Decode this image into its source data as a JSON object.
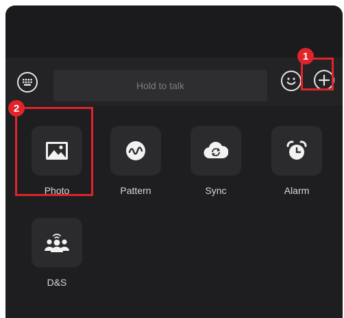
{
  "input_bar": {
    "hold_to_talk": "Hold to talk",
    "keyboard_icon": "keyboard-icon",
    "emoji_icon": "emoji-icon",
    "plus_icon": "plus-icon"
  },
  "features": [
    {
      "label": "Photo",
      "icon": "photo-icon"
    },
    {
      "label": "Pattern",
      "icon": "pattern-icon"
    },
    {
      "label": "Sync",
      "icon": "sync-icon"
    },
    {
      "label": "Alarm",
      "icon": "alarm-icon"
    },
    {
      "label": "D&S",
      "icon": "group-icon"
    }
  ],
  "annotations": {
    "badge_1": "1",
    "badge_2": "2",
    "color": "#e0242a"
  },
  "colors": {
    "background": "#1c1c1e",
    "tile": "#2b2b2d",
    "text": "#d9d9dc"
  }
}
